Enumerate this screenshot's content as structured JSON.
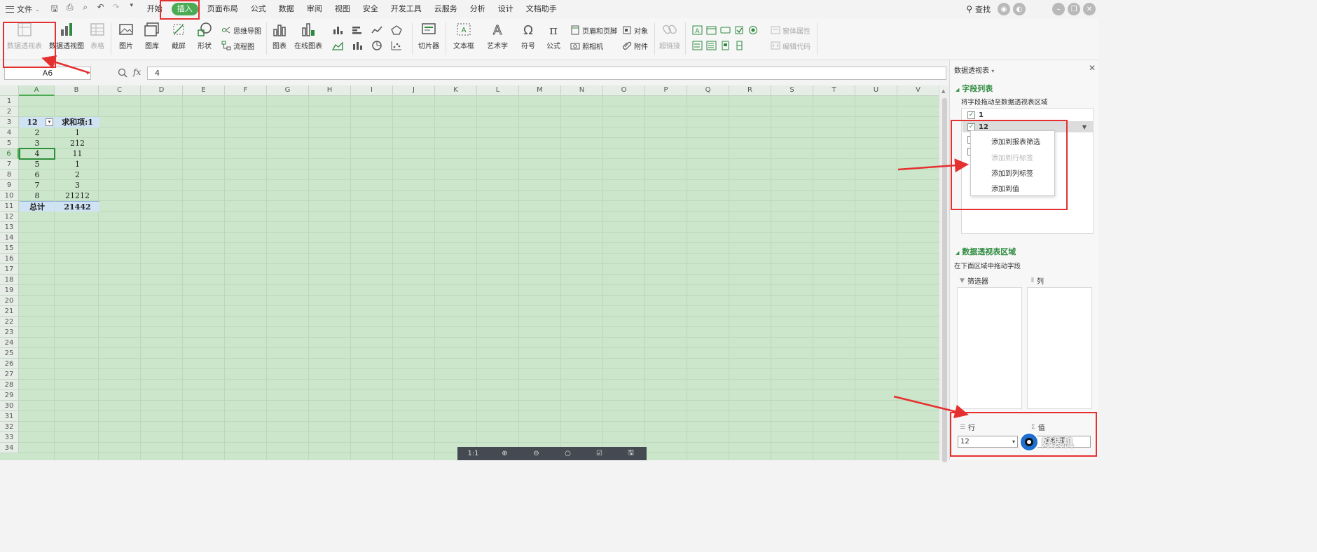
{
  "menubar": {
    "file_label": "文件",
    "tabs": [
      {
        "label": "开始"
      },
      {
        "label": "插入"
      },
      {
        "label": "页面布局"
      },
      {
        "label": "公式"
      },
      {
        "label": "数据"
      },
      {
        "label": "审阅"
      },
      {
        "label": "视图"
      },
      {
        "label": "安全"
      },
      {
        "label": "开发工具"
      },
      {
        "label": "云服务"
      },
      {
        "label": "分析"
      },
      {
        "label": "设计"
      },
      {
        "label": "文档助手"
      }
    ],
    "active_tab": "插入",
    "search_label": "查找"
  },
  "ribbon": {
    "pivot_table": "数据透视表",
    "pivot_chart": "数据透视图",
    "table": "表格",
    "picture": "图片",
    "gallery": "图库",
    "screenshot": "截屏",
    "shapes": "形状",
    "mindmap": "思维导图",
    "flowchart": "流程图",
    "chart": "图表",
    "online_chart": "在线图表",
    "slicer": "切片器",
    "textbox": "文本框",
    "wordart": "艺术字",
    "symbol": "符号",
    "formula": "公式",
    "header_footer": "页眉和页脚",
    "camera": "照相机",
    "object": "对象",
    "attachment": "附件",
    "hyperlink": "超链接",
    "form_props": "窗体属性",
    "edit_code": "编辑代码"
  },
  "formula_bar": {
    "name_box": "A6",
    "fx": "fx",
    "value": "4"
  },
  "sheet": {
    "columns": [
      "A",
      "B",
      "C",
      "D",
      "E",
      "F",
      "G",
      "H",
      "I",
      "J",
      "K",
      "L",
      "M",
      "N",
      "O",
      "P",
      "Q",
      "R",
      "S",
      "T",
      "U",
      "V"
    ],
    "rows": [
      "1",
      "2",
      "3",
      "4",
      "5",
      "6",
      "7",
      "8",
      "9",
      "10",
      "11",
      "12",
      "13",
      "14",
      "15",
      "16",
      "17",
      "18",
      "19",
      "20",
      "21",
      "22",
      "23",
      "24",
      "25",
      "26",
      "27",
      "28",
      "29",
      "30",
      "31",
      "32",
      "33",
      "34"
    ],
    "selected_cell": "A6",
    "pivot": {
      "header_row_label": "12",
      "header_value_label": "求和项:1",
      "rows": [
        {
          "label": "2",
          "value": "1"
        },
        {
          "label": "3",
          "value": "212"
        },
        {
          "label": "4",
          "value": "11"
        },
        {
          "label": "5",
          "value": "1"
        },
        {
          "label": "6",
          "value": "2"
        },
        {
          "label": "7",
          "value": "3"
        },
        {
          "label": "8",
          "value": "21212"
        }
      ],
      "total_label": "总计",
      "total_value": "21442"
    }
  },
  "view_toolbar": {
    "ratio": "1:1"
  },
  "panel": {
    "title": "数据透视表",
    "field_list_title": "字段列表",
    "field_list_hint": "将字段拖动至数据透视表区域",
    "fields": [
      {
        "name": "1",
        "checked": true
      },
      {
        "name": "12",
        "checked": true
      }
    ],
    "context_menu": [
      {
        "label": "添加到报表筛选",
        "enabled": true
      },
      {
        "label": "添加到行标签",
        "enabled": false
      },
      {
        "label": "添加到列标签",
        "enabled": true
      },
      {
        "label": "添加到值",
        "enabled": true
      }
    ],
    "areas_title": "数据透视表区域",
    "areas_hint": "在下面区域中拖动字段",
    "filter_label": "筛选器",
    "column_label": "列",
    "row_label": "行",
    "value_label": "值",
    "row_field": "12",
    "value_field": "求和项"
  },
  "watermark": "好装机",
  "colors": {
    "accent": "#4bab55",
    "grid_bg": "#cce6cc",
    "annotation": "#e53030",
    "pivot_header": "#cfe3f4"
  }
}
